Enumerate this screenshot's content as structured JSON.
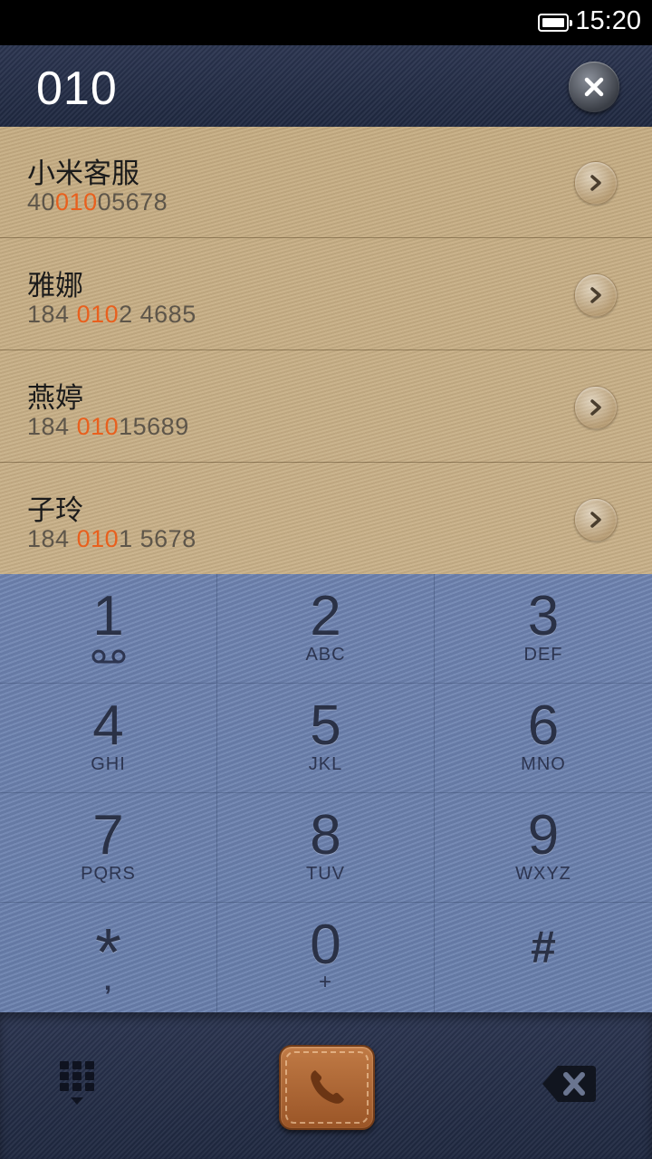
{
  "status_bar": {
    "time": "15:20",
    "battery_icon": "battery-full-icon"
  },
  "dialer": {
    "input": "010",
    "clear_icon": "close-icon"
  },
  "contacts": [
    {
      "name": "小米客服",
      "num_pre": "40",
      "num_hl": "010",
      "num_post": "05678"
    },
    {
      "name": "雅娜",
      "num_pre": "184 ",
      "num_hl": "010",
      "num_post": "2 4685"
    },
    {
      "name": "燕婷",
      "num_pre": "184 ",
      "num_hl": "010",
      "num_post": "15689"
    },
    {
      "name": "子玲",
      "num_pre": "184 ",
      "num_hl": "010",
      "num_post": "1 5678"
    }
  ],
  "keypad": [
    {
      "digit": "1",
      "letters": "",
      "icon": "voicemail-icon"
    },
    {
      "digit": "2",
      "letters": "ABC"
    },
    {
      "digit": "3",
      "letters": "DEF"
    },
    {
      "digit": "4",
      "letters": "GHI"
    },
    {
      "digit": "5",
      "letters": "JKL"
    },
    {
      "digit": "6",
      "letters": "MNO"
    },
    {
      "digit": "7",
      "letters": "PQRS"
    },
    {
      "digit": "8",
      "letters": "TUV"
    },
    {
      "digit": "9",
      "letters": "WXYZ"
    },
    {
      "digit": "*",
      "letters": ","
    },
    {
      "digit": "0",
      "letters": "+"
    },
    {
      "digit": "#",
      "letters": ""
    }
  ],
  "bottom_bar": {
    "keypad_toggle_icon": "keypad-hide-icon",
    "call_icon": "phone-icon",
    "backspace_icon": "backspace-icon"
  },
  "colors": {
    "highlight": "#e8601e",
    "call_button": "#a85f2e"
  }
}
